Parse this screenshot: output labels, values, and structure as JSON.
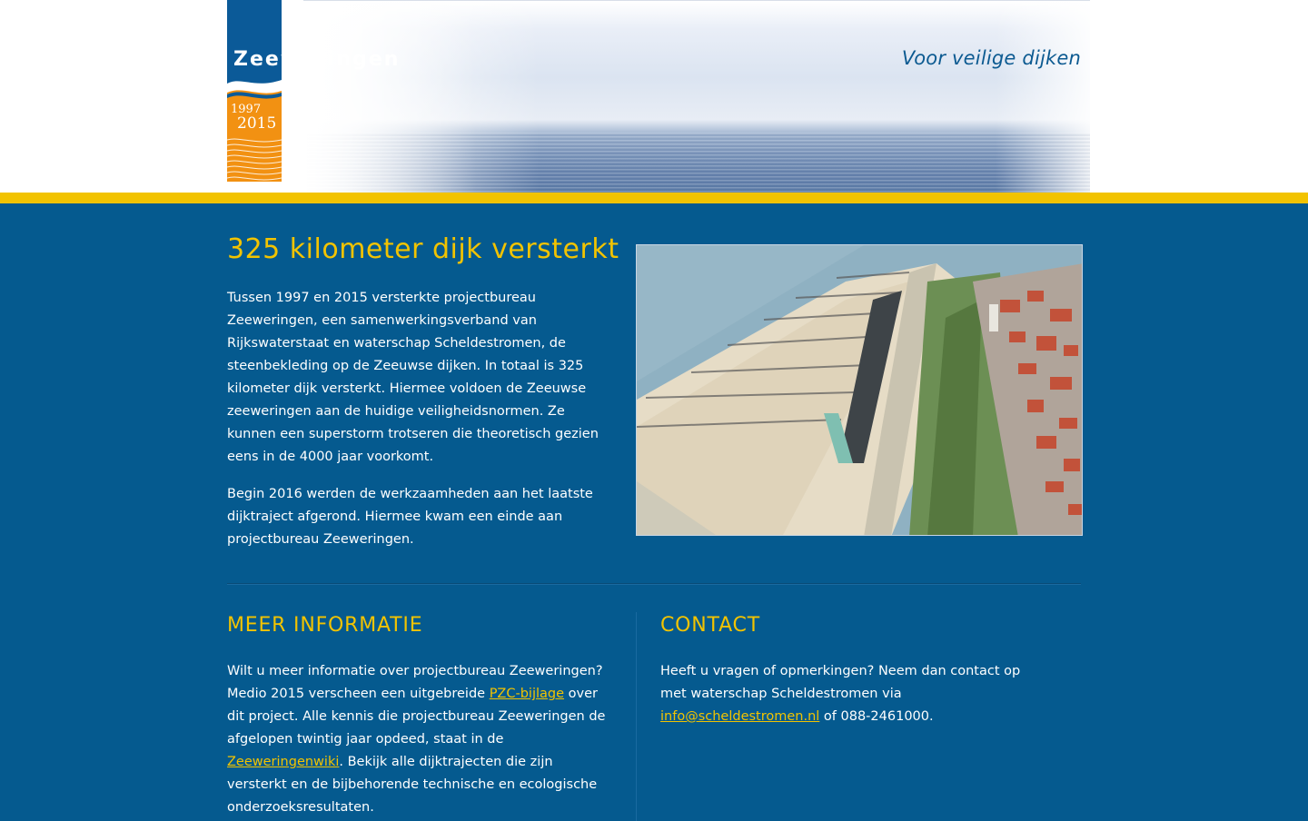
{
  "header": {
    "logo": {
      "wordmark": "Zeeweringen",
      "year_start": "1997",
      "year_end": "2015"
    },
    "tagline": "Voor veilige dijken"
  },
  "colors": {
    "brand_blue": "#055a8f",
    "accent_yellow": "#f2c300",
    "logo_orange": "#f29112"
  },
  "main": {
    "title": "325 kilometer dijk versterkt",
    "paragraphs": [
      "Tussen 1997 en 2015 versterkte projectbureau Zeeweringen, een samenwerkingsverband van Rijkswaterstaat en waterschap Scheldestromen, de steenbekleding op de Zeeuwse dijken. In totaal is 325 kilometer dijk versterkt. Hiermee voldoen de Zeeuwse zeeweringen aan de huidige veiligheidsnormen. Ze kunnen een superstorm trotseren die theoretisch gezien eens in de 4000 jaar voorkomt.",
      "Begin 2016 werden de werkzaamheden aan het laatste dijktraject afgerond. Hiermee kwam een einde aan projectbureau Zeeweringen."
    ]
  },
  "info": {
    "heading": "MEER INFORMATIE",
    "text_1": "Wilt u meer informatie over projectbureau Zeeweringen? Medio 2015 verscheen een uitgebreide ",
    "link_1": "PZC-bijlage",
    "text_2": " over dit project. Alle kennis die projectbureau Zeeweringen de afgelopen twintig jaar opdeed, staat in de ",
    "link_2": "Zeeweringenwiki",
    "text_3": ". Bekijk alle dijktrajecten die zijn versterkt en de bijbehorende technische en ecologische onderzoeksresultaten."
  },
  "contact": {
    "heading": "CONTACT",
    "text_1": "Heeft u vragen of opmerkingen? Neem dan contact op met waterschap Scheldestromen via ",
    "email": "info@scheldestromen.nl",
    "text_2": " of 088-2461000."
  }
}
